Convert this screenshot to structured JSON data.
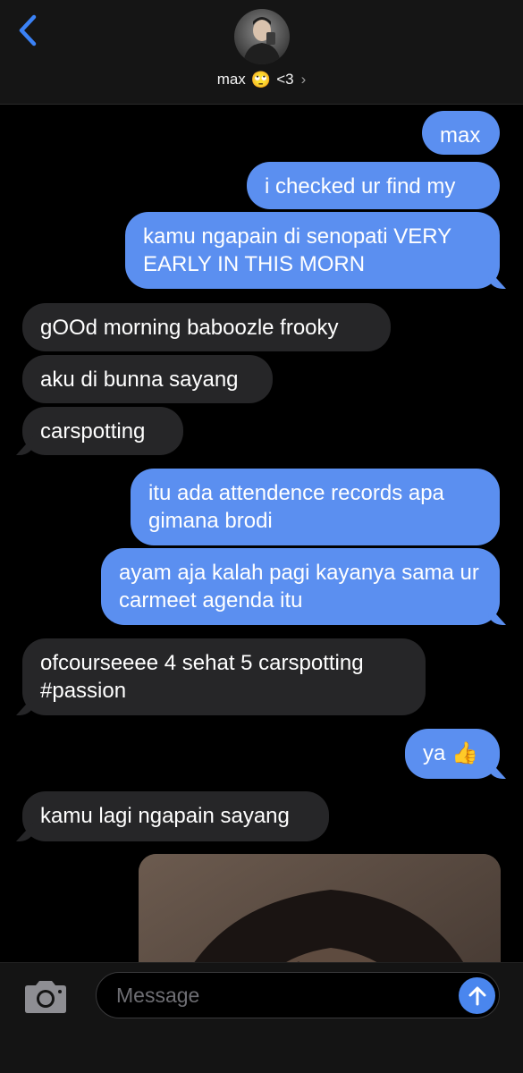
{
  "header": {
    "contact_name": "max",
    "contact_emoji": "🙄",
    "contact_suffix": "<3",
    "chevron": "›"
  },
  "messages": [
    {
      "dir": "out",
      "text": "max"
    },
    {
      "dir": "out",
      "text": "i checked ur find my"
    },
    {
      "dir": "out",
      "text": "kamu ngapain di senopati VERY EARLY IN THIS MORN"
    },
    {
      "dir": "in",
      "text": "gOOd morning baboozle frooky"
    },
    {
      "dir": "in",
      "text": "aku di bunna sayang"
    },
    {
      "dir": "in",
      "text": "carspotting"
    },
    {
      "dir": "out",
      "text": "itu ada attendence records apa gimana brodi"
    },
    {
      "dir": "out",
      "text": "ayam aja kalah pagi kayanya sama ur carmeet agenda itu"
    },
    {
      "dir": "in",
      "text": "ofcourseeee 4 sehat 5 carspotting #passion"
    },
    {
      "dir": "out",
      "text": "ya 👍"
    },
    {
      "dir": "in",
      "text": "kamu lagi ngapain sayang"
    }
  ],
  "input": {
    "placeholder": "Message"
  },
  "colors": {
    "outgoing_bubble": "#5b8ff0",
    "incoming_bubble": "#262628",
    "accent": "#4a86ee"
  },
  "icons": {
    "back": "chevron-left-icon",
    "camera": "camera-icon",
    "send": "arrow-up-icon"
  }
}
